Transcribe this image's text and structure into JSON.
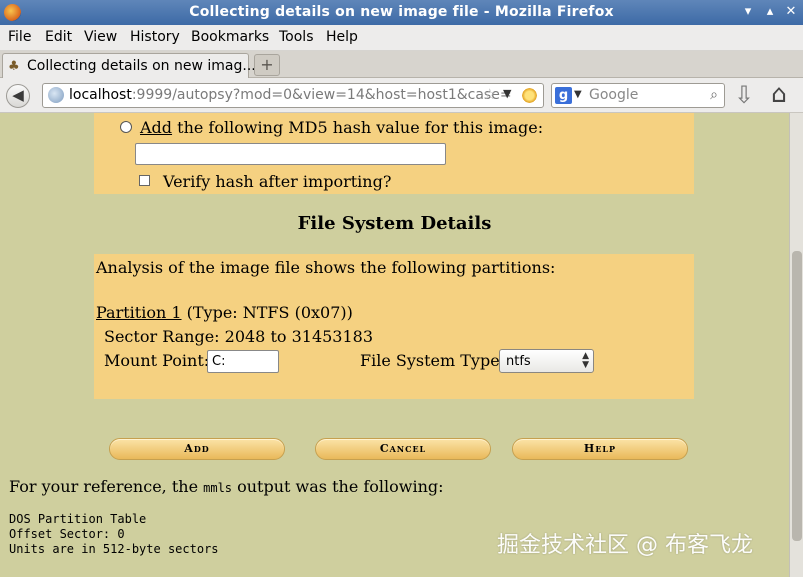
{
  "window": {
    "title": "Collecting details on new image file - Mozilla Firefox",
    "controls": {
      "minimize": "▾",
      "maximize": "▴",
      "close": "✕"
    }
  },
  "menu": [
    "File",
    "Edit",
    "View",
    "History",
    "Bookmarks",
    "Tools",
    "Help"
  ],
  "tab": {
    "title": "Collecting details on new imag...",
    "new_tab_symbol": "+"
  },
  "nav": {
    "url_host": "localhost",
    "url_rest": ":9999/autopsy?mod=0&view=14&host=host1&case=",
    "search_engine_letter": "g",
    "search_placeholder": "Google"
  },
  "hash_section": {
    "add_link": "Add",
    "label_rest": " the following MD5 hash value for this image:",
    "hash_value": "",
    "verify_label": "Verify hash after importing?",
    "verify_checked": false
  },
  "fs_section": {
    "title": "File System Details",
    "analysis_text": "Analysis of the image file shows the following partitions:",
    "partition_link": "Partition 1",
    "partition_type": " (Type: NTFS (0x07))",
    "sector_range": "Sector Range: 2048 to 31453183",
    "mount_label": "Mount Point:",
    "mount_value": "C:",
    "fs_type_label": "File System Type:",
    "fs_type_value": "ntfs"
  },
  "buttons": {
    "add": "Add",
    "cancel": "Cancel",
    "help": "Help"
  },
  "reference": {
    "prefix": "For your reference, the ",
    "tool": "mmls",
    "suffix": " output was the following:",
    "line1": "DOS Partition Table",
    "line2": "Offset Sector: 0",
    "line3": "Units are in 512-byte sectors"
  },
  "watermark": "掘金技术社区 @ 布客飞龙",
  "colors": {
    "page_bg": "#cfcf9e",
    "panel_bg": "#f5d181",
    "titlebar": "#4a76ae"
  }
}
